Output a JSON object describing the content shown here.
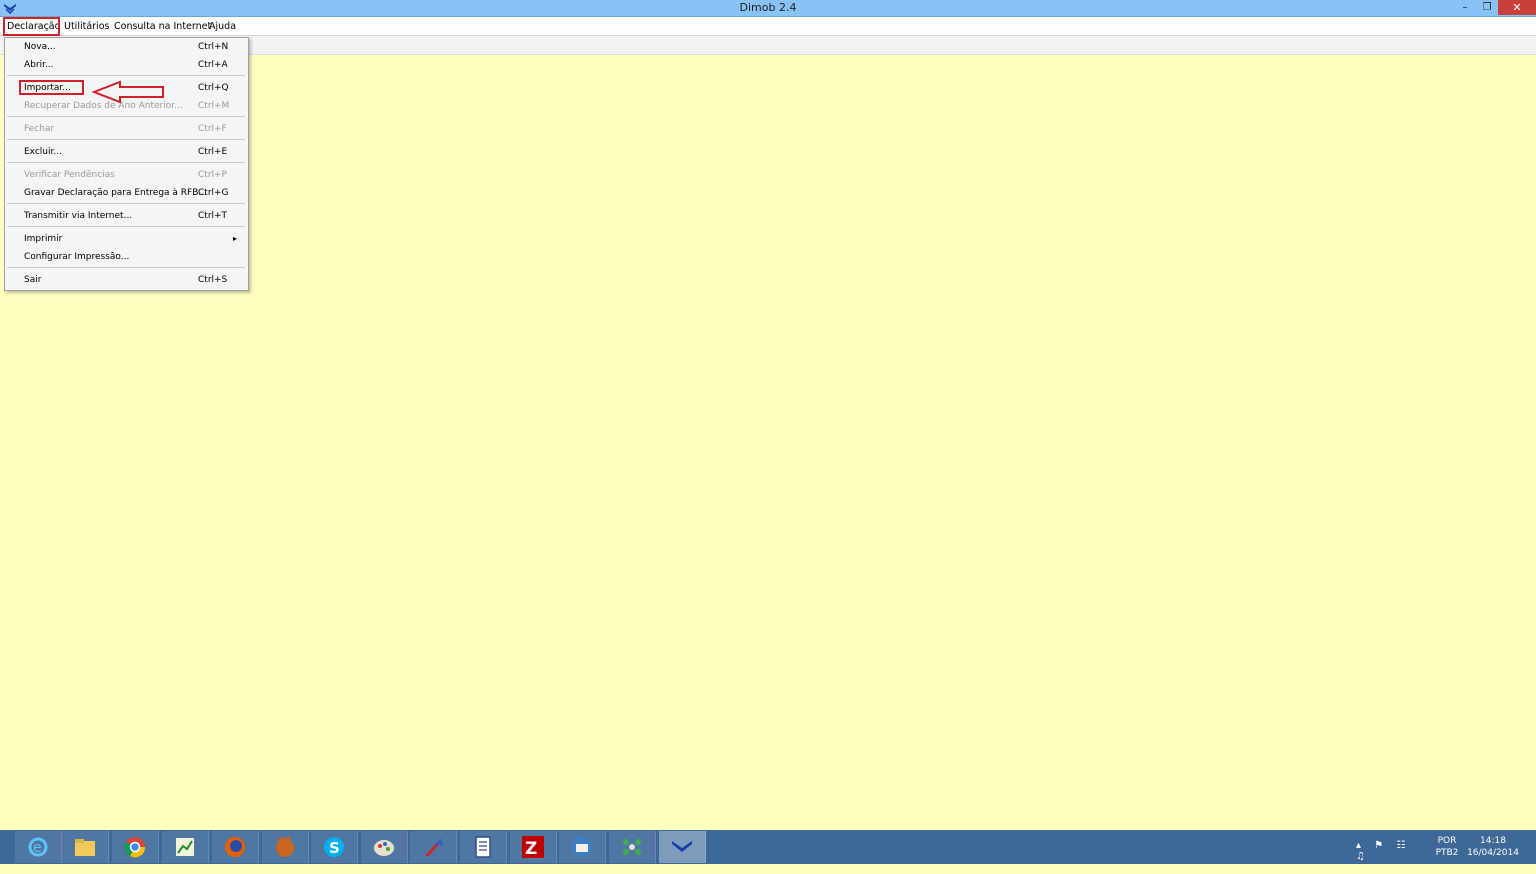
{
  "window": {
    "title": "Dimob 2.4",
    "min_label": "–",
    "max_label": "❐",
    "close_label": "✕"
  },
  "menubar": {
    "items": [
      "Declaração",
      "Utilitários",
      "Consulta na Internet",
      "Ajuda"
    ]
  },
  "dropdown": {
    "items": [
      {
        "label": "Nova...",
        "shortcut": "Ctrl+N",
        "enabled": true
      },
      {
        "label": "Abrir...",
        "shortcut": "Ctrl+A",
        "enabled": true
      },
      {
        "label": "Importar...",
        "shortcut": "Ctrl+Q",
        "enabled": true
      },
      {
        "label": "Recuperar Dados de Ano Anterior...",
        "shortcut": "Ctrl+M",
        "enabled": false
      },
      {
        "label": "Fechar",
        "shortcut": "Ctrl+F",
        "enabled": false
      },
      {
        "label": "Excluir...",
        "shortcut": "Ctrl+E",
        "enabled": true
      },
      {
        "label": "Verificar Pendências",
        "shortcut": "Ctrl+P",
        "enabled": false
      },
      {
        "label": "Gravar Declaração para Entrega à RFB...",
        "shortcut": "Ctrl+G",
        "enabled": true
      },
      {
        "label": "Transmitir via Internet...",
        "shortcut": "Ctrl+T",
        "enabled": true
      },
      {
        "label": "Imprimir",
        "shortcut": "",
        "enabled": true,
        "submenu": true
      },
      {
        "label": "Configurar Impressão...",
        "shortcut": "",
        "enabled": true
      },
      {
        "label": "Sair",
        "shortcut": "Ctrl+S",
        "enabled": true
      }
    ],
    "submenu_arrow": "▸"
  },
  "annotation": {
    "highlight_color": "#d0202a"
  },
  "taskbar": {
    "apps": [
      "internet-explorer-icon",
      "file-explorer-icon",
      "chrome-icon",
      "chart-app-icon",
      "firefox-icon",
      "glove-app-icon",
      "skype-icon",
      "paint-icon",
      "rocket-app-icon",
      "document-icon",
      "filezilla-icon",
      "thunderbird-icon",
      "network-app-icon",
      "dimob-icon"
    ],
    "lang_line1": "POR",
    "lang_line2": "PTB2",
    "time": "14:18",
    "date": "16/04/2014",
    "tray_icons": "▴ ⚑ ☷ ♫"
  },
  "colors": {
    "background": "#ffffc0",
    "titlebar": "#87c3f5",
    "taskbar": "#3d6898",
    "close_button": "#c7413a"
  }
}
